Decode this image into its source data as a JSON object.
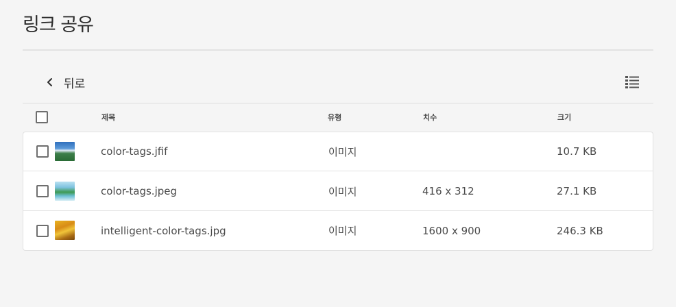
{
  "page": {
    "title": "링크 공유"
  },
  "toolbar": {
    "back_label": "뒤로",
    "back_icon": "chevron-left-icon",
    "view_icon": "list-view-icon"
  },
  "table": {
    "headers": {
      "title": "제목",
      "type": "유형",
      "dimensions": "치수",
      "size": "크기"
    },
    "rows": [
      {
        "name": "color-tags.jfif",
        "type": "이미지",
        "dimensions": "",
        "size": "10.7 KB",
        "thumbnail": "mountain-lake-thumbnail"
      },
      {
        "name": "color-tags.jpeg",
        "type": "이미지",
        "dimensions": "416 x 312",
        "size": "27.1 KB",
        "thumbnail": "waterfall-thumbnail"
      },
      {
        "name": "intelligent-color-tags.jpg",
        "type": "이미지",
        "dimensions": "1600 x 900",
        "size": "246.3 KB",
        "thumbnail": "autumn-trees-thumbnail"
      }
    ]
  },
  "colors": {
    "background": "#f5f5f5",
    "text": "#2c2c2c",
    "secondary_text": "#4b4b4b",
    "border": "#e1e1e1",
    "checkbox_border": "#6e6e6e"
  }
}
